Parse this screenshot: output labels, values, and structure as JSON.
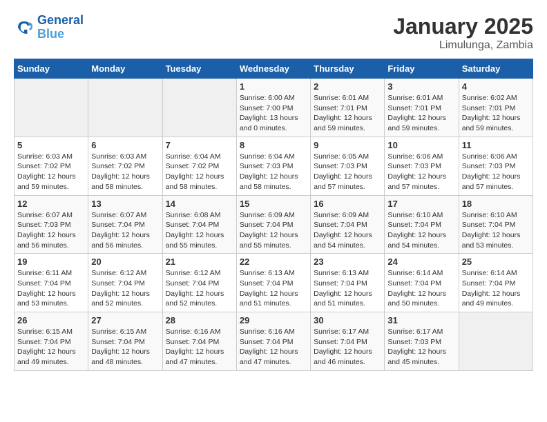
{
  "header": {
    "logo_line1": "General",
    "logo_line2": "Blue",
    "title": "January 2025",
    "subtitle": "Limulunga, Zambia"
  },
  "weekdays": [
    "Sunday",
    "Monday",
    "Tuesday",
    "Wednesday",
    "Thursday",
    "Friday",
    "Saturday"
  ],
  "weeks": [
    [
      {
        "num": "",
        "info": ""
      },
      {
        "num": "",
        "info": ""
      },
      {
        "num": "",
        "info": ""
      },
      {
        "num": "1",
        "info": "Sunrise: 6:00 AM\nSunset: 7:00 PM\nDaylight: 13 hours\nand 0 minutes."
      },
      {
        "num": "2",
        "info": "Sunrise: 6:01 AM\nSunset: 7:01 PM\nDaylight: 12 hours\nand 59 minutes."
      },
      {
        "num": "3",
        "info": "Sunrise: 6:01 AM\nSunset: 7:01 PM\nDaylight: 12 hours\nand 59 minutes."
      },
      {
        "num": "4",
        "info": "Sunrise: 6:02 AM\nSunset: 7:01 PM\nDaylight: 12 hours\nand 59 minutes."
      }
    ],
    [
      {
        "num": "5",
        "info": "Sunrise: 6:03 AM\nSunset: 7:02 PM\nDaylight: 12 hours\nand 59 minutes."
      },
      {
        "num": "6",
        "info": "Sunrise: 6:03 AM\nSunset: 7:02 PM\nDaylight: 12 hours\nand 58 minutes."
      },
      {
        "num": "7",
        "info": "Sunrise: 6:04 AM\nSunset: 7:02 PM\nDaylight: 12 hours\nand 58 minutes."
      },
      {
        "num": "8",
        "info": "Sunrise: 6:04 AM\nSunset: 7:03 PM\nDaylight: 12 hours\nand 58 minutes."
      },
      {
        "num": "9",
        "info": "Sunrise: 6:05 AM\nSunset: 7:03 PM\nDaylight: 12 hours\nand 57 minutes."
      },
      {
        "num": "10",
        "info": "Sunrise: 6:06 AM\nSunset: 7:03 PM\nDaylight: 12 hours\nand 57 minutes."
      },
      {
        "num": "11",
        "info": "Sunrise: 6:06 AM\nSunset: 7:03 PM\nDaylight: 12 hours\nand 57 minutes."
      }
    ],
    [
      {
        "num": "12",
        "info": "Sunrise: 6:07 AM\nSunset: 7:03 PM\nDaylight: 12 hours\nand 56 minutes."
      },
      {
        "num": "13",
        "info": "Sunrise: 6:07 AM\nSunset: 7:04 PM\nDaylight: 12 hours\nand 56 minutes."
      },
      {
        "num": "14",
        "info": "Sunrise: 6:08 AM\nSunset: 7:04 PM\nDaylight: 12 hours\nand 55 minutes."
      },
      {
        "num": "15",
        "info": "Sunrise: 6:09 AM\nSunset: 7:04 PM\nDaylight: 12 hours\nand 55 minutes."
      },
      {
        "num": "16",
        "info": "Sunrise: 6:09 AM\nSunset: 7:04 PM\nDaylight: 12 hours\nand 54 minutes."
      },
      {
        "num": "17",
        "info": "Sunrise: 6:10 AM\nSunset: 7:04 PM\nDaylight: 12 hours\nand 54 minutes."
      },
      {
        "num": "18",
        "info": "Sunrise: 6:10 AM\nSunset: 7:04 PM\nDaylight: 12 hours\nand 53 minutes."
      }
    ],
    [
      {
        "num": "19",
        "info": "Sunrise: 6:11 AM\nSunset: 7:04 PM\nDaylight: 12 hours\nand 53 minutes."
      },
      {
        "num": "20",
        "info": "Sunrise: 6:12 AM\nSunset: 7:04 PM\nDaylight: 12 hours\nand 52 minutes."
      },
      {
        "num": "21",
        "info": "Sunrise: 6:12 AM\nSunset: 7:04 PM\nDaylight: 12 hours\nand 52 minutes."
      },
      {
        "num": "22",
        "info": "Sunrise: 6:13 AM\nSunset: 7:04 PM\nDaylight: 12 hours\nand 51 minutes."
      },
      {
        "num": "23",
        "info": "Sunrise: 6:13 AM\nSunset: 7:04 PM\nDaylight: 12 hours\nand 51 minutes."
      },
      {
        "num": "24",
        "info": "Sunrise: 6:14 AM\nSunset: 7:04 PM\nDaylight: 12 hours\nand 50 minutes."
      },
      {
        "num": "25",
        "info": "Sunrise: 6:14 AM\nSunset: 7:04 PM\nDaylight: 12 hours\nand 49 minutes."
      }
    ],
    [
      {
        "num": "26",
        "info": "Sunrise: 6:15 AM\nSunset: 7:04 PM\nDaylight: 12 hours\nand 49 minutes."
      },
      {
        "num": "27",
        "info": "Sunrise: 6:15 AM\nSunset: 7:04 PM\nDaylight: 12 hours\nand 48 minutes."
      },
      {
        "num": "28",
        "info": "Sunrise: 6:16 AM\nSunset: 7:04 PM\nDaylight: 12 hours\nand 47 minutes."
      },
      {
        "num": "29",
        "info": "Sunrise: 6:16 AM\nSunset: 7:04 PM\nDaylight: 12 hours\nand 47 minutes."
      },
      {
        "num": "30",
        "info": "Sunrise: 6:17 AM\nSunset: 7:04 PM\nDaylight: 12 hours\nand 46 minutes."
      },
      {
        "num": "31",
        "info": "Sunrise: 6:17 AM\nSunset: 7:03 PM\nDaylight: 12 hours\nand 45 minutes."
      },
      {
        "num": "",
        "info": ""
      }
    ]
  ]
}
